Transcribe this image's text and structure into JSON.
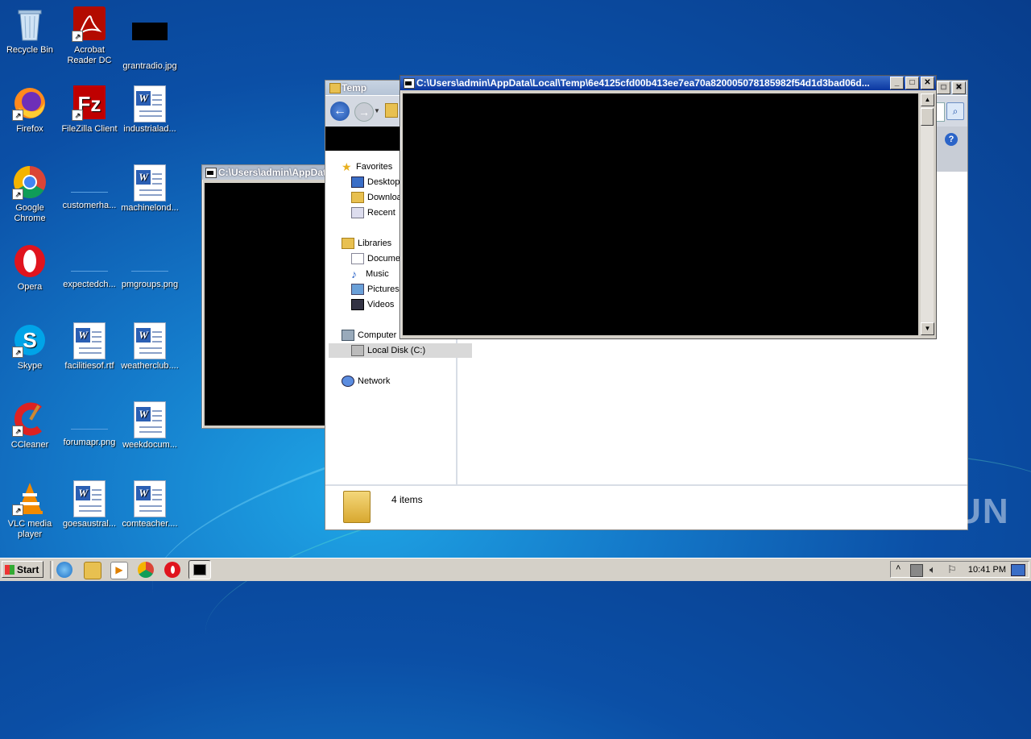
{
  "desktop": {
    "icons": [
      {
        "label": "Recycle Bin",
        "icon": "recycle-bin-icon"
      },
      {
        "label": "Acrobat Reader DC",
        "icon": "acrobat-icon"
      },
      {
        "label": "grantradio.jpg",
        "icon": "image-file-icon"
      },
      {
        "label": "Firefox",
        "icon": "firefox-icon"
      },
      {
        "label": "FileZilla Client",
        "icon": "filezilla-icon"
      },
      {
        "label": "industrialad...",
        "icon": "word-doc-icon"
      },
      {
        "label": "Google Chrome",
        "icon": "chrome-icon"
      },
      {
        "label": "customerha...",
        "icon": "image-file-icon"
      },
      {
        "label": "machinelond...",
        "icon": "word-doc-icon"
      },
      {
        "label": "Opera",
        "icon": "opera-icon"
      },
      {
        "label": "expectedch...",
        "icon": "image-file-icon"
      },
      {
        "label": "pmgroups.png",
        "icon": "image-file-icon"
      },
      {
        "label": "Skype",
        "icon": "skype-icon"
      },
      {
        "label": "facilitiesof.rtf",
        "icon": "word-doc-icon"
      },
      {
        "label": "weatherclub....",
        "icon": "word-doc-icon"
      },
      {
        "label": "CCleaner",
        "icon": "ccleaner-icon"
      },
      {
        "label": "forumapr.png",
        "icon": "image-file-icon"
      },
      {
        "label": "weekdocum...",
        "icon": "word-doc-icon"
      },
      {
        "label": "VLC media player",
        "icon": "vlc-icon"
      },
      {
        "label": "goesaustral...",
        "icon": "word-doc-icon"
      },
      {
        "label": "comteacher....",
        "icon": "word-doc-icon"
      }
    ]
  },
  "cmd_back": {
    "title": "C:\\Users\\admin\\AppData"
  },
  "explorer": {
    "title": "Temp",
    "status": "4 items",
    "nav": {
      "favorites": "Favorites",
      "desktop": "Desktop",
      "downloads": "Downloa",
      "recent": "Recent",
      "libraries": "Libraries",
      "documents": "Docume",
      "music": "Music",
      "pictures": "Pictures",
      "videos": "Videos",
      "computer": "Computer",
      "local_disk": "Local Disk (C:)",
      "network": "Network"
    }
  },
  "cmd_front": {
    "title": "C:\\Users\\admin\\AppData\\Local\\Temp\\6e4125cfd00b413ee7ea70a820005078185982f54d1d3bad06d..."
  },
  "taskbar": {
    "start_label": "Start",
    "clock": "10:41 PM"
  },
  "watermark": "ANY RUN",
  "colors": {
    "desktop_blue": "#1479c9",
    "titlebar_active": "#0a36a0",
    "titlebar_inactive": "#a9b6c8",
    "console_bg": "#000000"
  }
}
